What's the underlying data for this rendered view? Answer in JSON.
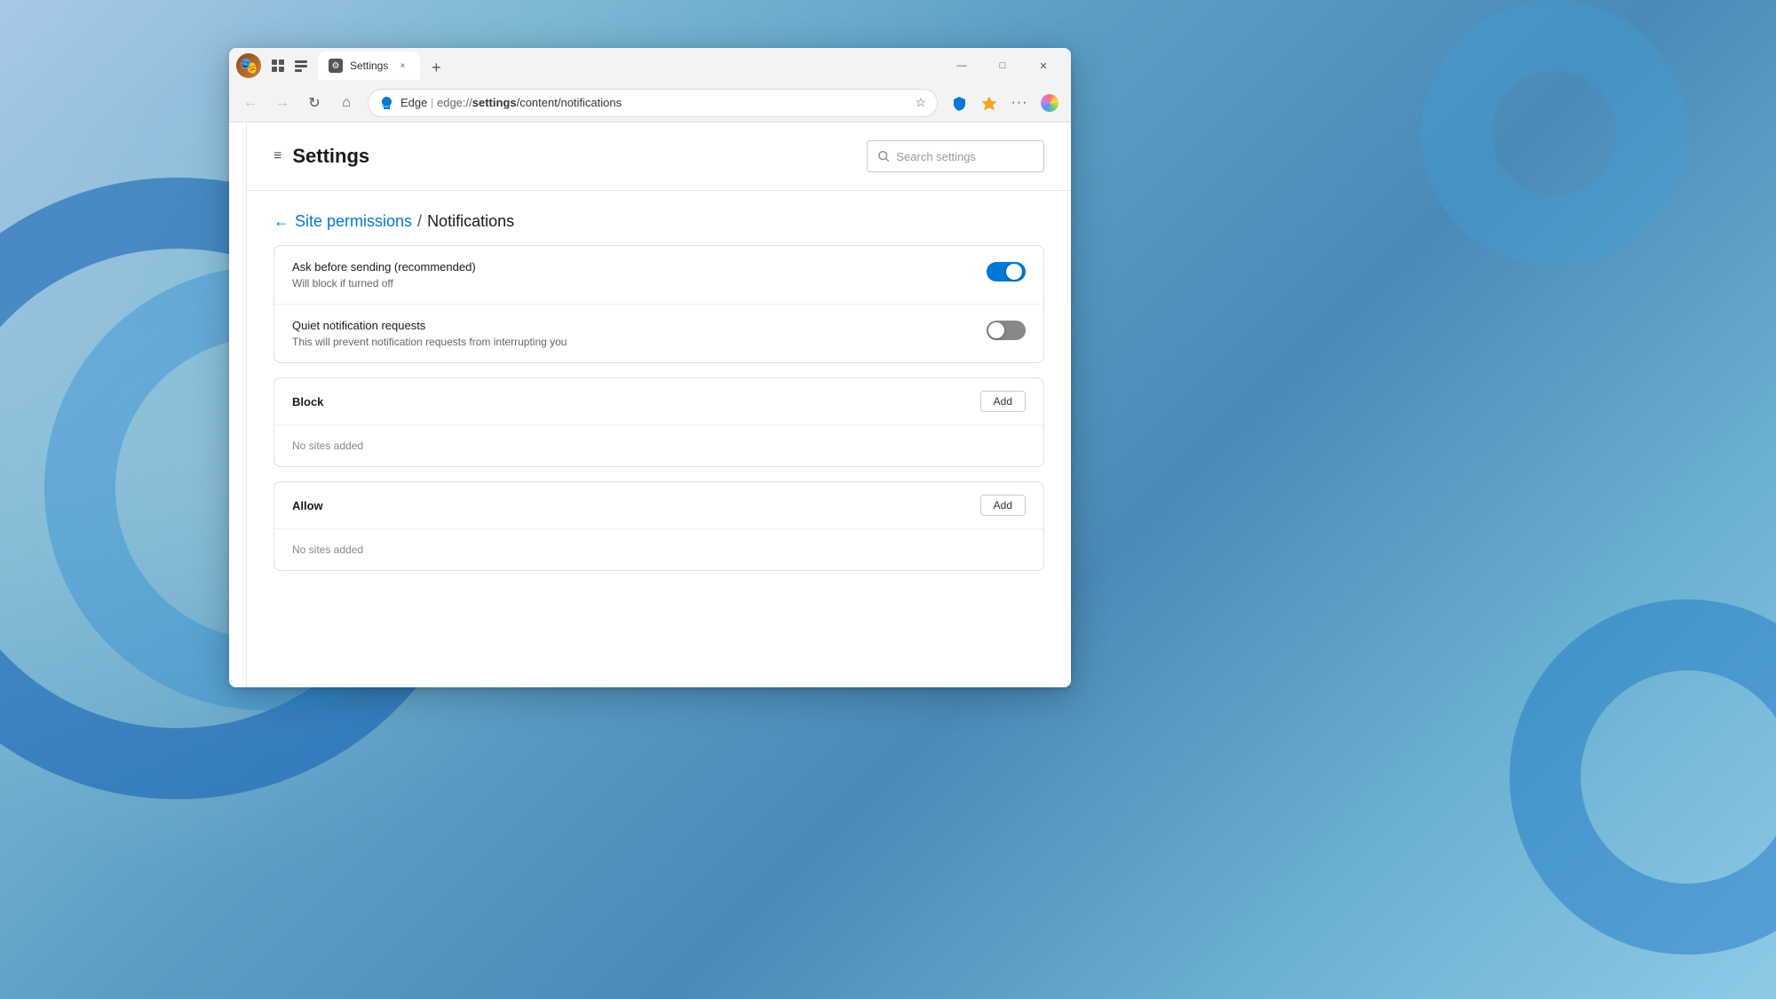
{
  "background": {
    "swirls": [
      "swirl1",
      "swirl2",
      "swirl3",
      "swirl4"
    ]
  },
  "browser": {
    "profile_initial": "👤",
    "tab": {
      "favicon_char": "⚙",
      "title": "Settings",
      "close_label": "×"
    },
    "new_tab_label": "+",
    "window_controls": {
      "minimize": "—",
      "maximize": "□",
      "close": "✕"
    },
    "nav": {
      "back_label": "←",
      "forward_label": "→",
      "refresh_label": "↻",
      "home_label": "⌂",
      "address": {
        "site": "Edge",
        "separator": " | ",
        "url": "edge://settings/content/notifications"
      },
      "favorite_label": "☆",
      "extensions_label": "🧩",
      "collections_label": "★",
      "more_label": "···"
    }
  },
  "settings": {
    "hamburger_label": "≡",
    "title": "Settings",
    "search": {
      "placeholder": "Search settings"
    },
    "breadcrumb": {
      "back_label": "←",
      "parent": "Site permissions",
      "separator": "/",
      "current": "Notifications"
    },
    "toggles_card": {
      "ask_before_sending": {
        "label": "Ask before sending (recommended)",
        "sublabel": "Will block if turned off",
        "state": "on"
      },
      "quiet_notifications": {
        "label": "Quiet notification requests",
        "sublabel": "This will prevent notification requests from interrupting you",
        "state": "off"
      }
    },
    "block_section": {
      "title": "Block",
      "add_button_label": "Add",
      "empty_message": "No sites added"
    },
    "allow_section": {
      "title": "Allow",
      "add_button_label": "Add",
      "empty_message": "No sites added"
    }
  }
}
